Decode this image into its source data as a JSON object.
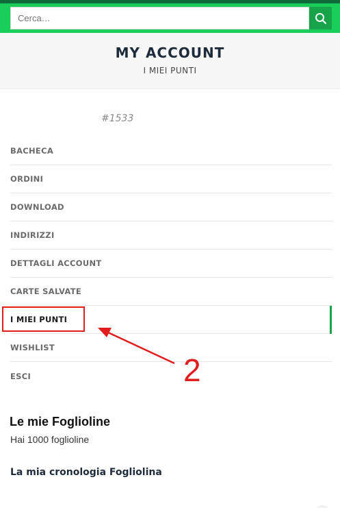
{
  "search": {
    "placeholder": "Cerca…",
    "icon": "search-icon"
  },
  "header": {
    "title": "MY ACCOUNT",
    "subtitle": "I MIEI PUNTI"
  },
  "user": {
    "id": "#1533"
  },
  "nav": {
    "items": [
      {
        "label": "BACHECA"
      },
      {
        "label": "ORDINI"
      },
      {
        "label": "DOWNLOAD"
      },
      {
        "label": "INDIRIZZI"
      },
      {
        "label": "DETTAGLI ACCOUNT"
      },
      {
        "label": "CARTE SALVATE"
      },
      {
        "label": "I MIEI PUNTI"
      },
      {
        "label": "WISHLIST"
      },
      {
        "label": "ESCI"
      }
    ],
    "active": "I MIEI PUNTI"
  },
  "annotation": {
    "number": "2"
  },
  "points": {
    "heading": "Le mie Foglioline",
    "summary": "Hai 1000 foglioline",
    "history_heading": "La mia cronologia Fogliolina"
  },
  "colors": {
    "brand_green": "#19cf5a",
    "button_green": "#16a34a",
    "annotation_red": "#e11d1d"
  }
}
